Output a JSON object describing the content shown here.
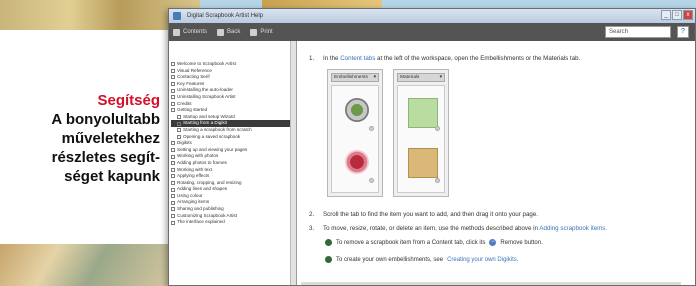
{
  "caption": {
    "title": "Segítség",
    "body": "A bonyolultabb\nműveletekhez\nrészletes segít-\nséget kapunk"
  },
  "window": {
    "title": "Digital Scrapbook Artist Help",
    "buttons": {
      "min": "_",
      "max": "□",
      "close": "x"
    },
    "toolbar": {
      "contents": "Contents",
      "back": "Back",
      "print": "Print"
    },
    "search_placeholder": "Search",
    "help_icon": "?"
  },
  "toc": [
    {
      "label": "Welcome to Scrapbook Artist",
      "level": 0
    },
    {
      "label": "Visual Reference",
      "level": 0
    },
    {
      "label": "Contacting Serif",
      "level": 0
    },
    {
      "label": "Key Features",
      "level": 0
    },
    {
      "label": "Uninstalling the auto-loader",
      "level": 0
    },
    {
      "label": "Uninstalling Scrapbook Artist",
      "level": 0
    },
    {
      "label": "Credits",
      "level": 0
    },
    {
      "label": "Getting started",
      "level": 0
    },
    {
      "label": "Startup and setup Wizard",
      "level": 1
    },
    {
      "label": "Starting from a Digikit",
      "level": 1,
      "selected": true
    },
    {
      "label": "Starting a scrapbook from scratch",
      "level": 1
    },
    {
      "label": "Opening a saved scrapbook",
      "level": 1
    },
    {
      "label": "Digikits",
      "level": 0
    },
    {
      "label": "Setting up and viewing your pages",
      "level": 0
    },
    {
      "label": "Working with photos",
      "level": 0
    },
    {
      "label": "Adding photos to frames",
      "level": 0
    },
    {
      "label": "Working with text",
      "level": 0
    },
    {
      "label": "Applying effects",
      "level": 0
    },
    {
      "label": "Rotating, cropping, and resizing",
      "level": 0
    },
    {
      "label": "Adding lines and shapes",
      "level": 0
    },
    {
      "label": "Using colour",
      "level": 0
    },
    {
      "label": "Arranging items",
      "level": 0
    },
    {
      "label": "Sharing and publishing",
      "level": 0
    },
    {
      "label": "Customizing Scrapbook Artist",
      "level": 0
    },
    {
      "label": "The interface explained",
      "level": 0
    }
  ],
  "main": {
    "step1": {
      "num": "1.",
      "pre": "In the",
      "link": "Content tabs",
      "post": "at the left of the workspace, open the Embellishments or the Materials tab."
    },
    "panel1_title": "Embellishments",
    "panel2_title": "Materials",
    "step2": {
      "num": "2.",
      "text": "Scroll the tab to find the item you want to add, and then drag it onto your page."
    },
    "step3": {
      "num": "3.",
      "text": "To move, resize, rotate, or delete an item, use the methods described above in",
      "link": "Adding scrapbook items."
    },
    "note1": {
      "text": "To remove a scrapbook item from a Content tab, click its",
      "post": "Remove button."
    },
    "note2": {
      "pre": "To create your own embellishments, see",
      "link": "Creating your own Digikits."
    }
  }
}
